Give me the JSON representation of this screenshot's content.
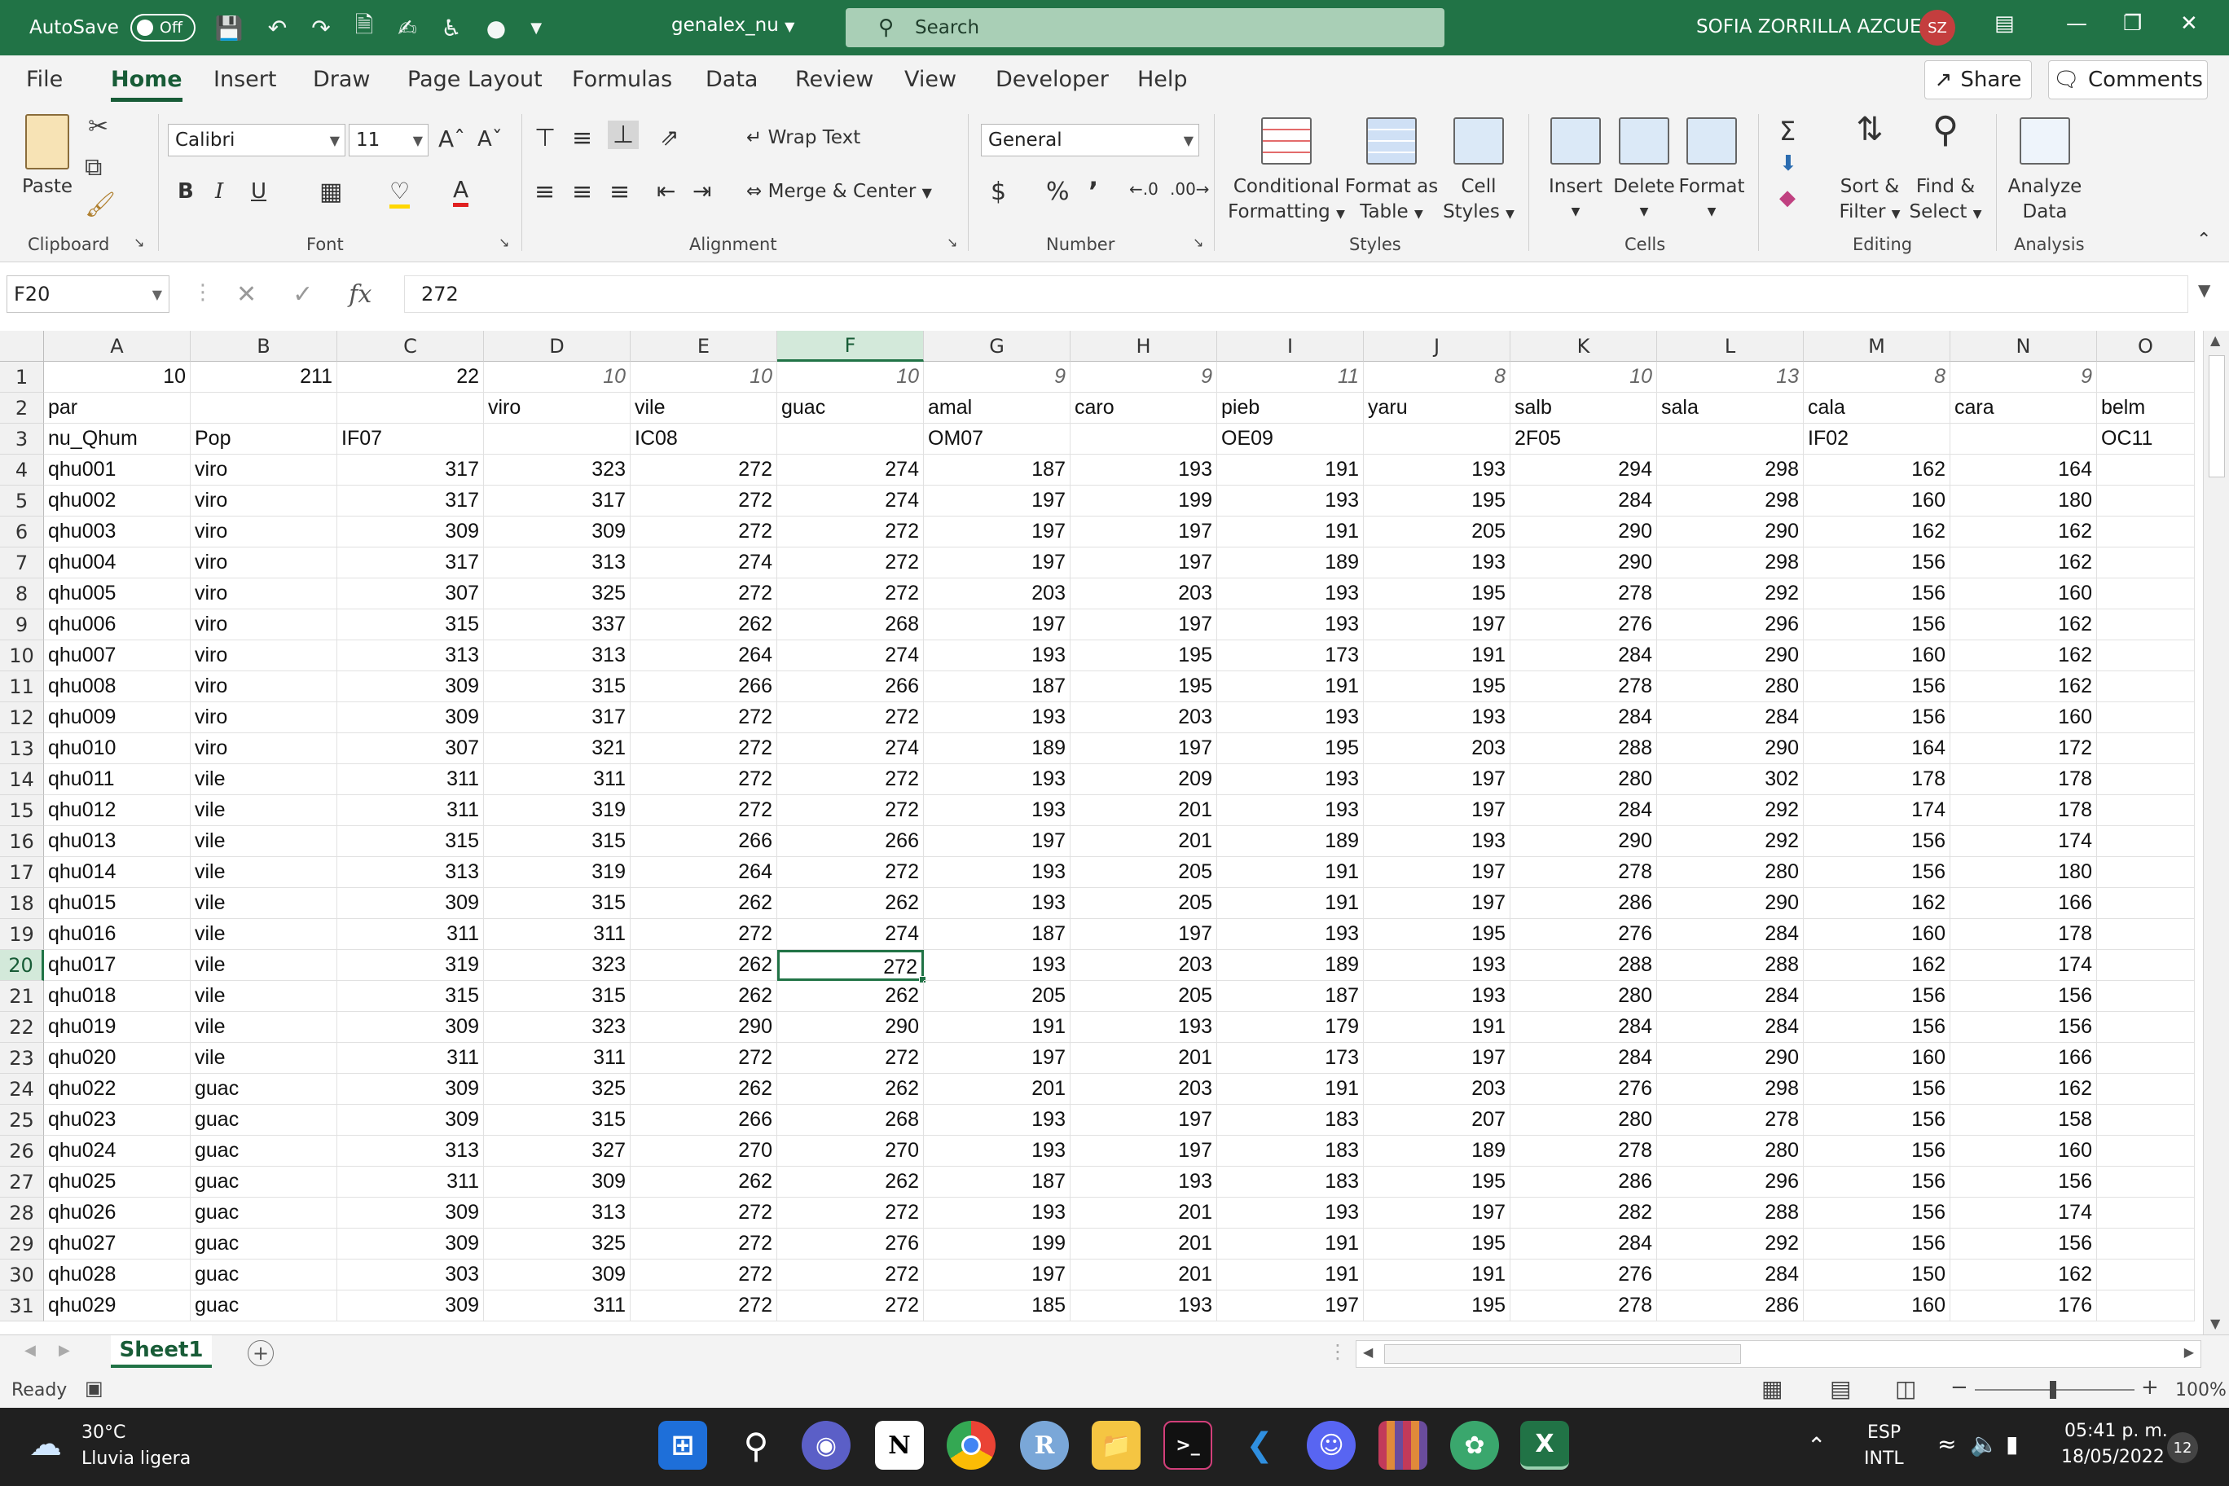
{
  "titlebar": {
    "autosave_label": "AutoSave",
    "autosave_state": "Off",
    "filename": "genalex_nu",
    "search_placeholder": "Search",
    "user_name": "SOFIA ZORRILLA AZCUE",
    "user_initials": "SZ"
  },
  "tabs": [
    "File",
    "Home",
    "Insert",
    "Draw",
    "Page Layout",
    "Formulas",
    "Data",
    "Review",
    "View",
    "Developer",
    "Help"
  ],
  "share_label": "Share",
  "comments_label": "Comments",
  "ribbon": {
    "clipboard": {
      "paste": "Paste",
      "label": "Clipboard"
    },
    "font": {
      "name": "Calibri",
      "size": "11",
      "label": "Font"
    },
    "alignment": {
      "wrap": "Wrap Text",
      "merge": "Merge & Center",
      "label": "Alignment"
    },
    "number": {
      "format": "General",
      "label": "Number"
    },
    "styles": {
      "conditional1": "Conditional",
      "conditional2": "Formatting",
      "table1": "Format as",
      "table2": "Table",
      "cell1": "Cell",
      "cell2": "Styles",
      "label": "Styles"
    },
    "cells": {
      "insert": "Insert",
      "delete": "Delete",
      "format": "Format",
      "label": "Cells"
    },
    "editing": {
      "sort1": "Sort &",
      "sort2": "Filter",
      "find1": "Find &",
      "find2": "Select",
      "label": "Editing"
    },
    "analysis": {
      "analyze1": "Analyze",
      "analyze2": "Data",
      "label": "Analysis"
    }
  },
  "formula_bar": {
    "name_box": "F20",
    "formula": "272"
  },
  "columns": [
    "A",
    "B",
    "C",
    "D",
    "E",
    "F",
    "G",
    "H",
    "I",
    "J",
    "K",
    "L",
    "M",
    "N",
    "O"
  ],
  "rows": [
    [
      "10",
      "211",
      "22",
      "10",
      "10",
      "10",
      "9",
      "9",
      "11",
      "8",
      "10",
      "13",
      "8",
      "9",
      ""
    ],
    [
      "par",
      "",
      "",
      "viro",
      "vile",
      "guac",
      "amal",
      "caro",
      "pieb",
      "yaru",
      "salb",
      "sala",
      "cala",
      "cara",
      "belm"
    ],
    [
      "nu_Qhum",
      "Pop",
      "IF07",
      "",
      "IC08",
      "",
      "OM07",
      "",
      "OE09",
      "",
      "2F05",
      "",
      "IF02",
      "",
      "OC11"
    ],
    [
      "qhu001",
      "viro",
      "317",
      "323",
      "272",
      "274",
      "187",
      "193",
      "191",
      "193",
      "294",
      "298",
      "162",
      "164",
      ""
    ],
    [
      "qhu002",
      "viro",
      "317",
      "317",
      "272",
      "274",
      "197",
      "199",
      "193",
      "195",
      "284",
      "298",
      "160",
      "180",
      ""
    ],
    [
      "qhu003",
      "viro",
      "309",
      "309",
      "272",
      "272",
      "197",
      "197",
      "191",
      "205",
      "290",
      "290",
      "162",
      "162",
      ""
    ],
    [
      "qhu004",
      "viro",
      "317",
      "313",
      "274",
      "272",
      "197",
      "197",
      "189",
      "193",
      "290",
      "298",
      "156",
      "162",
      ""
    ],
    [
      "qhu005",
      "viro",
      "307",
      "325",
      "272",
      "272",
      "203",
      "203",
      "193",
      "195",
      "278",
      "292",
      "156",
      "160",
      ""
    ],
    [
      "qhu006",
      "viro",
      "315",
      "337",
      "262",
      "268",
      "197",
      "197",
      "193",
      "197",
      "276",
      "296",
      "156",
      "162",
      ""
    ],
    [
      "qhu007",
      "viro",
      "313",
      "313",
      "264",
      "274",
      "193",
      "195",
      "173",
      "191",
      "284",
      "290",
      "160",
      "162",
      ""
    ],
    [
      "qhu008",
      "viro",
      "309",
      "315",
      "266",
      "266",
      "187",
      "195",
      "191",
      "195",
      "278",
      "280",
      "156",
      "162",
      ""
    ],
    [
      "qhu009",
      "viro",
      "309",
      "317",
      "272",
      "272",
      "193",
      "203",
      "193",
      "193",
      "284",
      "284",
      "156",
      "160",
      ""
    ],
    [
      "qhu010",
      "viro",
      "307",
      "321",
      "272",
      "274",
      "189",
      "197",
      "195",
      "203",
      "288",
      "290",
      "164",
      "172",
      ""
    ],
    [
      "qhu011",
      "vile",
      "311",
      "311",
      "272",
      "272",
      "193",
      "209",
      "193",
      "197",
      "280",
      "302",
      "178",
      "178",
      ""
    ],
    [
      "qhu012",
      "vile",
      "311",
      "319",
      "272",
      "272",
      "193",
      "201",
      "193",
      "197",
      "284",
      "292",
      "174",
      "178",
      ""
    ],
    [
      "qhu013",
      "vile",
      "315",
      "315",
      "266",
      "266",
      "197",
      "201",
      "189",
      "193",
      "290",
      "292",
      "156",
      "174",
      ""
    ],
    [
      "qhu014",
      "vile",
      "313",
      "319",
      "264",
      "272",
      "193",
      "205",
      "191",
      "197",
      "278",
      "280",
      "156",
      "180",
      ""
    ],
    [
      "qhu015",
      "vile",
      "309",
      "315",
      "262",
      "262",
      "193",
      "205",
      "191",
      "197",
      "286",
      "290",
      "162",
      "166",
      ""
    ],
    [
      "qhu016",
      "vile",
      "311",
      "311",
      "272",
      "274",
      "187",
      "197",
      "193",
      "195",
      "276",
      "284",
      "160",
      "178",
      ""
    ],
    [
      "qhu017",
      "vile",
      "319",
      "323",
      "262",
      "272",
      "193",
      "203",
      "189",
      "193",
      "288",
      "288",
      "162",
      "174",
      ""
    ],
    [
      "qhu018",
      "vile",
      "315",
      "315",
      "262",
      "262",
      "205",
      "205",
      "187",
      "193",
      "280",
      "284",
      "156",
      "156",
      ""
    ],
    [
      "qhu019",
      "vile",
      "309",
      "323",
      "290",
      "290",
      "191",
      "193",
      "179",
      "191",
      "284",
      "284",
      "156",
      "156",
      ""
    ],
    [
      "qhu020",
      "vile",
      "311",
      "311",
      "272",
      "272",
      "197",
      "201",
      "173",
      "197",
      "284",
      "290",
      "160",
      "166",
      ""
    ],
    [
      "qhu022",
      "guac",
      "309",
      "325",
      "262",
      "262",
      "201",
      "203",
      "191",
      "203",
      "276",
      "298",
      "156",
      "162",
      ""
    ],
    [
      "qhu023",
      "guac",
      "309",
      "315",
      "266",
      "268",
      "193",
      "197",
      "183",
      "207",
      "280",
      "278",
      "156",
      "158",
      ""
    ],
    [
      "qhu024",
      "guac",
      "313",
      "327",
      "270",
      "270",
      "193",
      "197",
      "183",
      "189",
      "278",
      "280",
      "156",
      "160",
      ""
    ],
    [
      "qhu025",
      "guac",
      "311",
      "309",
      "262",
      "262",
      "187",
      "193",
      "183",
      "195",
      "286",
      "296",
      "156",
      "156",
      ""
    ],
    [
      "qhu026",
      "guac",
      "309",
      "313",
      "272",
      "272",
      "193",
      "201",
      "193",
      "197",
      "282",
      "288",
      "156",
      "174",
      ""
    ],
    [
      "qhu027",
      "guac",
      "309",
      "325",
      "272",
      "276",
      "199",
      "201",
      "191",
      "195",
      "284",
      "292",
      "156",
      "156",
      ""
    ],
    [
      "qhu028",
      "guac",
      "303",
      "309",
      "272",
      "272",
      "197",
      "201",
      "191",
      "191",
      "276",
      "284",
      "150",
      "162",
      ""
    ],
    [
      "qhu029",
      "guac",
      "309",
      "311",
      "272",
      "272",
      "185",
      "193",
      "197",
      "195",
      "278",
      "286",
      "160",
      "176",
      ""
    ]
  ],
  "sheet_tab": "Sheet1",
  "status": {
    "ready": "Ready",
    "zoom": "100%"
  },
  "taskbar": {
    "weather_temp": "30°C",
    "weather_desc": "Lluvia ligera",
    "lang1": "ESP",
    "lang2": "INTL",
    "time": "05:41 p. m.",
    "date": "18/05/2022",
    "notif_count": "12"
  }
}
